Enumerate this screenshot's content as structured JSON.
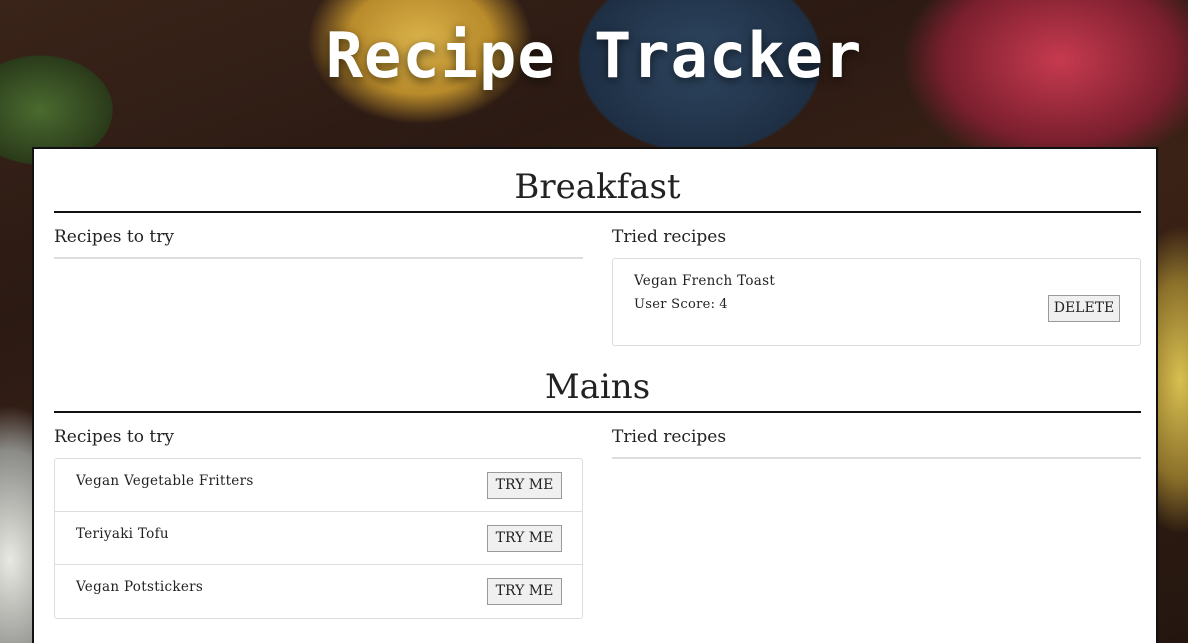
{
  "header": {
    "title": "Recipe Tracker"
  },
  "sections": [
    {
      "title": "Breakfast",
      "to_try": {
        "heading": "Recipes to try",
        "items": []
      },
      "tried": {
        "heading": "Tried recipes",
        "items": [
          {
            "name": "Vegan French Toast",
            "score_label": "User Score:",
            "score": "4",
            "action": "DELETE"
          }
        ]
      }
    },
    {
      "title": "Mains",
      "to_try": {
        "heading": "Recipes to try",
        "items": [
          {
            "name": "Vegan Vegetable Fritters",
            "action": "TRY ME"
          },
          {
            "name": "Teriyaki Tofu",
            "action": "TRY ME"
          },
          {
            "name": "Vegan Potstickers",
            "action": "TRY ME"
          }
        ]
      },
      "tried": {
        "heading": "Tried recipes",
        "items": []
      }
    }
  ]
}
